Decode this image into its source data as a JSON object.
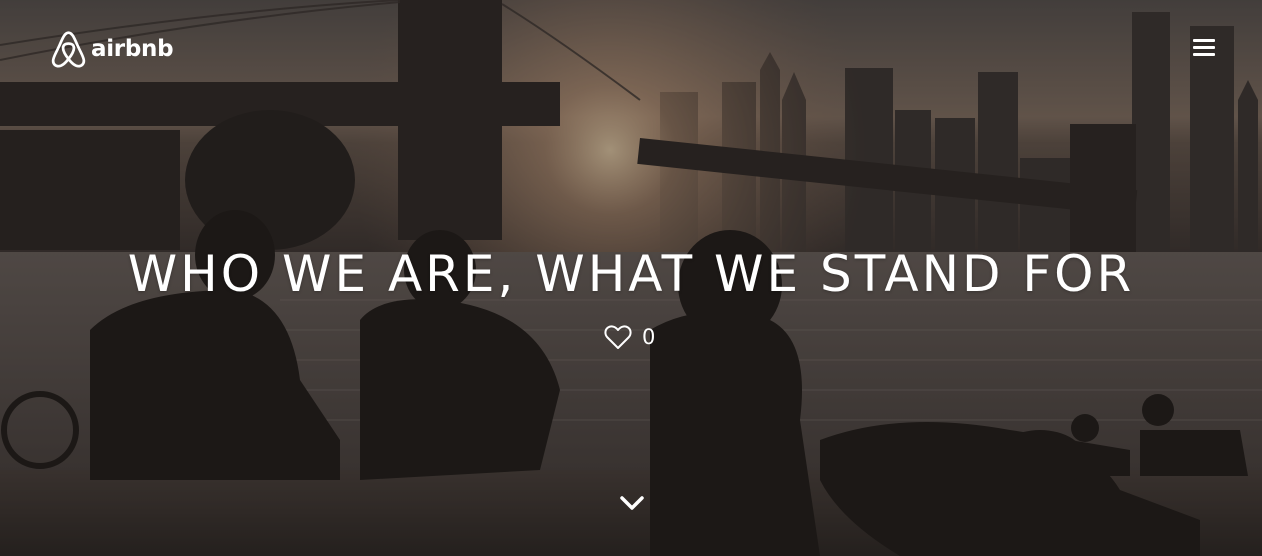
{
  "brand": {
    "name": "airbnb",
    "icon": "airbnb-belo-icon"
  },
  "menu": {
    "icon": "hamburger-menu-icon"
  },
  "hero": {
    "title": "WHO WE ARE, WHAT WE STAND FOR",
    "likes": {
      "icon": "heart-outline-icon",
      "count": "0"
    },
    "scroll_icon": "chevron-down-icon"
  },
  "colors": {
    "text": "#ffffff",
    "overlay": "#1e1a18",
    "sunlight": "#f4c79a"
  }
}
